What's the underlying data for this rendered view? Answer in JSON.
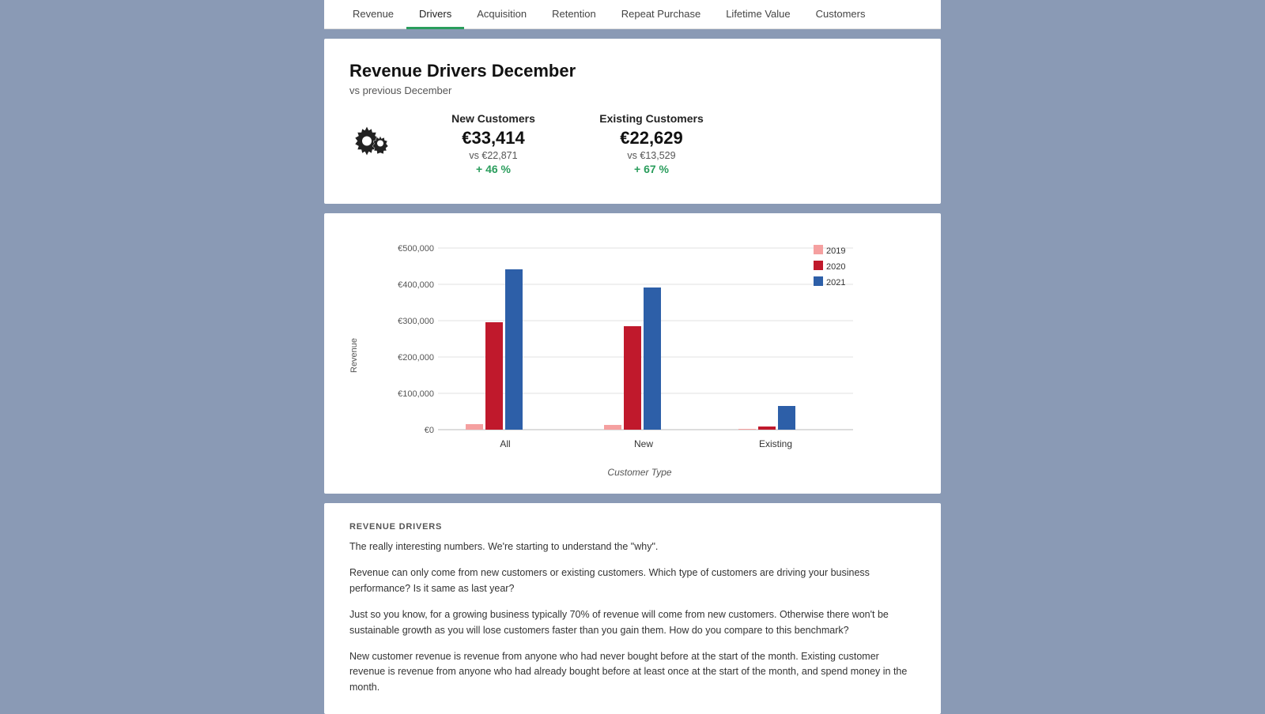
{
  "nav": {
    "items": [
      {
        "label": "Revenue",
        "active": false
      },
      {
        "label": "Drivers",
        "active": true
      },
      {
        "label": "Acquisition",
        "active": false
      },
      {
        "label": "Retention",
        "active": false
      },
      {
        "label": "Repeat Purchase",
        "active": false
      },
      {
        "label": "Lifetime Value",
        "active": false
      },
      {
        "label": "Customers",
        "active": false
      }
    ]
  },
  "header": {
    "title": "Revenue Drivers December",
    "subtitle": "vs previous December"
  },
  "kpi": {
    "new_customers": {
      "label": "New Customers",
      "value": "€33,414",
      "compare": "vs €22,871",
      "change": "+ 46 %"
    },
    "existing_customers": {
      "label": "Existing Customers",
      "value": "€22,629",
      "compare": "vs €13,529",
      "change": "+ 67 %"
    }
  },
  "chart": {
    "y_axis_label": "Revenue",
    "x_axis_label": "Customer Type",
    "y_ticks": [
      "€500,000",
      "€400,000",
      "€300,000",
      "€200,000",
      "€100,000",
      "€0"
    ],
    "groups": [
      {
        "label": "All"
      },
      {
        "label": "New"
      },
      {
        "label": "Existing"
      }
    ],
    "legend": [
      {
        "label": "2019",
        "color": "#f5a0a0"
      },
      {
        "label": "2020",
        "color": "#c0192c"
      },
      {
        "label": "2021",
        "color": "#2d5fa8"
      }
    ],
    "data": {
      "All": {
        "2019": 15000,
        "2020": 295000,
        "2021": 440000
      },
      "New": {
        "2019": 14000,
        "2020": 285000,
        "2021": 390000
      },
      "Existing": {
        "2019": 2000,
        "2020": 8000,
        "2021": 65000
      }
    },
    "max_value": 500000
  },
  "description": {
    "section_title": "REVENUE DRIVERS",
    "paragraphs": [
      "The really interesting numbers. We're starting to understand the \"why\".",
      "Revenue can only come from new customers or existing customers. Which type of customers are driving your business performance? Is it same as last year?",
      "Just so you know, for a growing business typically 70% of revenue will come from new customers. Otherwise there won't be sustainable growth as you will lose customers faster than you gain them. How do you compare to this benchmark?",
      "New customer revenue is revenue from anyone who had never bought before at the start of the month. Existing customer revenue is revenue from anyone who had already bought before at least once at the start of the month, and spend money in the month."
    ]
  }
}
